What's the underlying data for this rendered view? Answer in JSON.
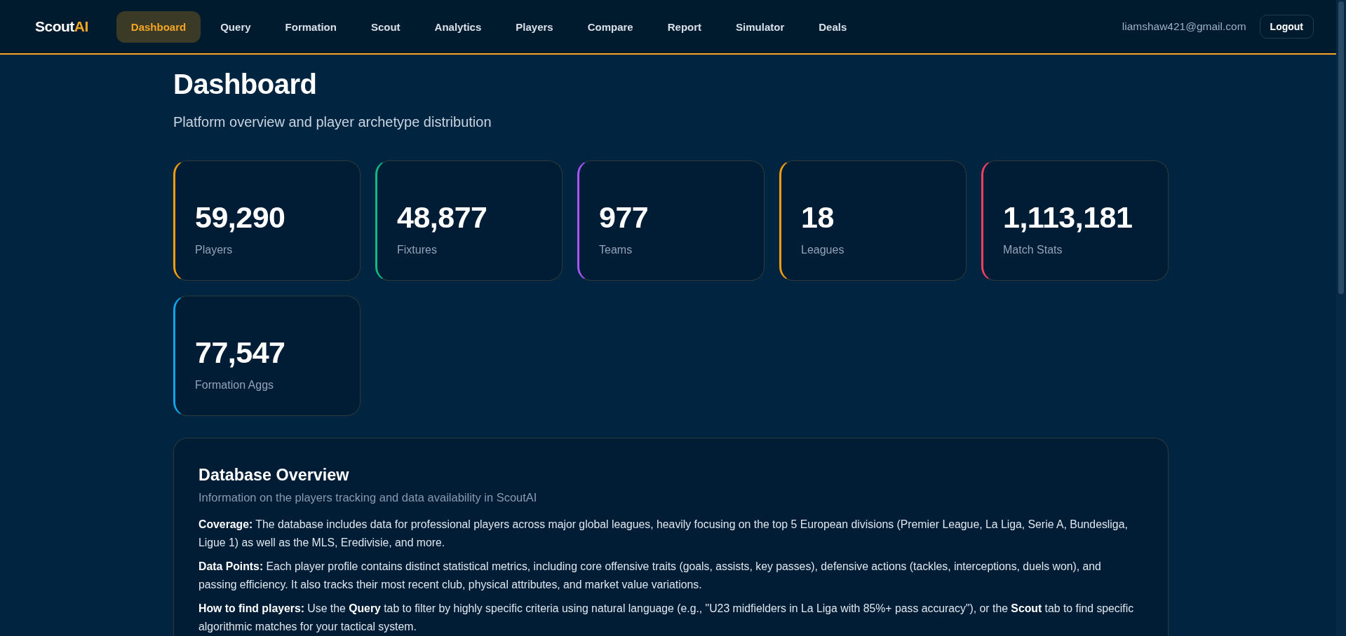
{
  "nav": {
    "logo": {
      "text": "Scout",
      "accent": "AI"
    },
    "tabs": [
      {
        "label": "Dashboard",
        "selected": true
      },
      {
        "label": "Query",
        "selected": false
      },
      {
        "label": "Formation",
        "selected": false
      },
      {
        "label": "Scout",
        "selected": false
      },
      {
        "label": "Analytics",
        "selected": false
      },
      {
        "label": "Players",
        "selected": false
      },
      {
        "label": "Compare",
        "selected": false
      },
      {
        "label": "Report",
        "selected": false
      },
      {
        "label": "Simulator",
        "selected": false
      },
      {
        "label": "Deals",
        "selected": false
      }
    ],
    "user_email": "liamshaw421@gmail.com",
    "logout_button": "Logout"
  },
  "header": {
    "title": "Dashboard",
    "subtitle": "Platform overview and player archetype distribution"
  },
  "stats": [
    {
      "value": "59,290",
      "label": "Players",
      "color": "#f59e0b"
    },
    {
      "value": "48,877",
      "label": "Fixtures",
      "color": "#10b981"
    },
    {
      "value": "977",
      "label": "Teams",
      "color": "#a855f7"
    },
    {
      "value": "18",
      "label": "Leagues",
      "color": "#f59e0b"
    },
    {
      "value": "1,113,181",
      "label": "Match Stats",
      "color": "#f43f5e"
    },
    {
      "value": "77,547",
      "label": "Formation Aggs",
      "color": "#0ea5e9"
    }
  ],
  "overview": {
    "title": "Database Overview",
    "subtitle": "Information on the players tracking and data availability in ScoutAI",
    "paragraphs": [
      "**Coverage:** The database includes data for professional players across major global leagues, heavily focusing on the top 5 European divisions (Premier League, La Liga, Serie A, Bundesliga, Ligue 1) as well as the MLS, Eredivisie, and more.",
      "**Data Points:** Each player profile contains distinct statistical metrics, including core offensive traits (goals, assists, key passes), defensive actions (tackles, interceptions, duels won), and passing efficiency. It also tracks their most recent club, physical attributes, and market value variations.",
      "**How to find players:** Use the **Query** tab to filter by highly specific criteria using natural language (e.g., \"U23 midfielders in La Liga with 85%+ pass accuracy\"), or the **Scout** tab to find specific algorithmic matches for your tactical system."
    ]
  }
}
